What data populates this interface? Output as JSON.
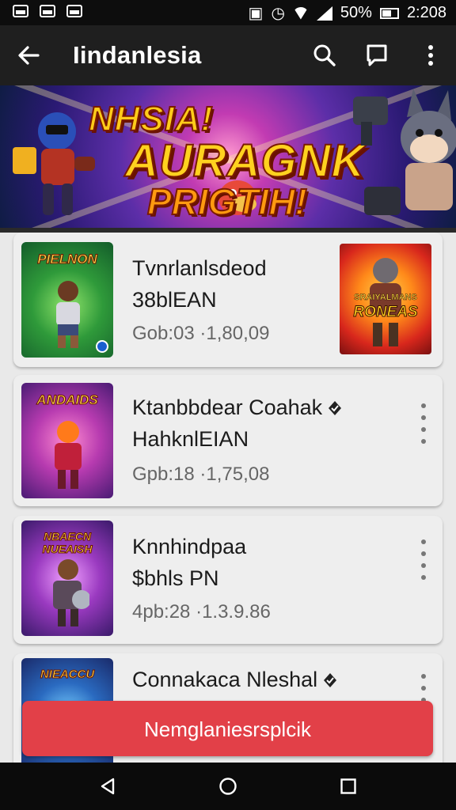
{
  "status_bar": {
    "battery": "50%",
    "time": "2:208"
  },
  "app_bar": {
    "title": "Iindanlesia",
    "back_icon": "arrow-left-icon",
    "search_icon": "search-icon",
    "chat_icon": "chat-icon",
    "more_icon": "more-vert-icon"
  },
  "banner": {
    "line1": "NHSIA!",
    "line2": "AURAGNK",
    "line3": "PRIGTIH!"
  },
  "list": {
    "items": [
      {
        "thumb_text": "PIELNON",
        "name": "Tvnrlanlsdeod",
        "sub": "38blEAN",
        "meta": "Gob:03 ·1,80,09",
        "has_thumb_right": true,
        "right_thumb_line1": "SRAIYALMANS",
        "right_thumb_line2": "RONEAS"
      },
      {
        "thumb_text": "ANDAIDS",
        "name": "Ktanbbdear Coahak",
        "sub": "HahknlEIAN",
        "meta": "Gpb:18 ·1,75,08",
        "verified": true
      },
      {
        "thumb_text": "NBAECN NUEAISH",
        "name": "Knnhindpaa",
        "sub": "$bhls PN",
        "meta": "4pb:28 ·1.3.9.86"
      },
      {
        "thumb_text": "NIEACCU",
        "name": "Connakaca Nleshal",
        "verified": true
      }
    ]
  },
  "cta": {
    "label": "Nemglaniesrsplcik"
  },
  "colors": {
    "accent": "#e24048",
    "appbar": "#1f1f1f"
  }
}
